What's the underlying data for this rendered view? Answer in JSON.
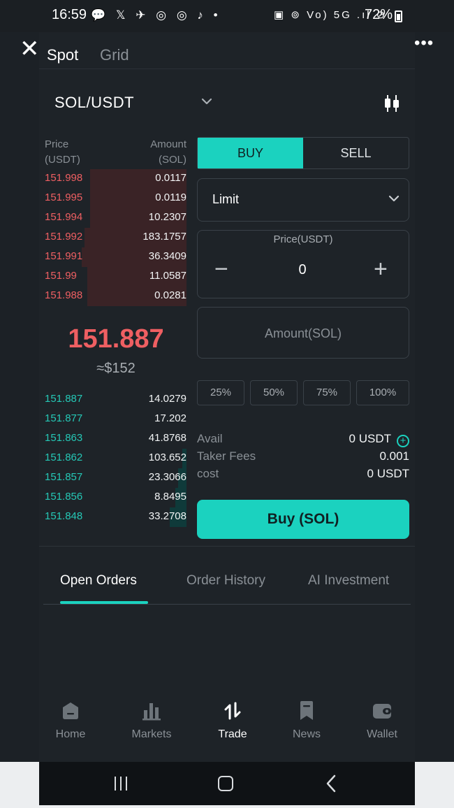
{
  "status_bar": {
    "time": "16:59",
    "battery": "72%",
    "notification_icons": "💬 𝕏 ✈ ◎ ◎ ♪ •",
    "system_icons": "▣ ⊚ Vo) 5G .ıl ⊘"
  },
  "header": {
    "tabs": [
      {
        "label": "Spot"
      },
      {
        "label": "Grid"
      }
    ],
    "pair": "SOL/USDT"
  },
  "orderbook": {
    "price_header": [
      "Price",
      "(USDT)"
    ],
    "amount_header": [
      "Amount",
      "(SOL)"
    ],
    "asks": [
      {
        "price": "151.998",
        "amount": "0.0117",
        "depth": 0.68
      },
      {
        "price": "151.995",
        "amount": "0.0119",
        "depth": 0.68
      },
      {
        "price": "151.994",
        "amount": "10.2307",
        "depth": 0.68
      },
      {
        "price": "151.992",
        "amount": "183.1757",
        "depth": 0.72
      },
      {
        "price": "151.991",
        "amount": "36.3409",
        "depth": 0.74
      },
      {
        "price": "151.99",
        "amount": "11.0587",
        "depth": 0.7
      },
      {
        "price": "151.988",
        "amount": "0.0281",
        "depth": 0.7
      }
    ],
    "last_price": "151.887",
    "last_price_usd": "≈$152",
    "bids": [
      {
        "price": "151.887",
        "amount": "14.0279",
        "depth": 0.0
      },
      {
        "price": "151.877",
        "amount": "17.202",
        "depth": 0.0
      },
      {
        "price": "151.863",
        "amount": "41.8768",
        "depth": 0.0
      },
      {
        "price": "151.862",
        "amount": "103.652",
        "depth": 0.03
      },
      {
        "price": "151.857",
        "amount": "23.3066",
        "depth": 0.06
      },
      {
        "price": "151.856",
        "amount": "8.8495",
        "depth": 0.08
      },
      {
        "price": "151.848",
        "amount": "33.2708",
        "depth": 0.12
      }
    ]
  },
  "order_form": {
    "buy_label": "BUY",
    "sell_label": "SELL",
    "order_type": "Limit",
    "price_label": "Price(USDT)",
    "price_value": "0",
    "minus": "−",
    "plus": "+",
    "amount_placeholder": "Amount(SOL)",
    "percent_buttons": [
      "25%",
      "50%",
      "75%",
      "100%"
    ],
    "avail_label": "Avail",
    "avail_value": "0 USDT",
    "fees_label": "Taker Fees",
    "fees_value": "0.001",
    "cost_label": "cost",
    "cost_value": "0 USDT",
    "submit_label": "Buy (SOL)"
  },
  "orders_tabs": [
    "Open Orders",
    "Order History",
    "AI Investment"
  ],
  "bottom_nav": [
    {
      "label": "Home",
      "icon": "home-icon"
    },
    {
      "label": "Markets",
      "icon": "markets-icon"
    },
    {
      "label": "Trade",
      "icon": "trade-icon"
    },
    {
      "label": "News",
      "icon": "news-icon"
    },
    {
      "label": "Wallet",
      "icon": "wallet-icon"
    }
  ],
  "colors": {
    "accent": "#1bd2bf",
    "ask": "#ef5f62",
    "bid": "#25c8b6",
    "background": "#1e2328"
  }
}
